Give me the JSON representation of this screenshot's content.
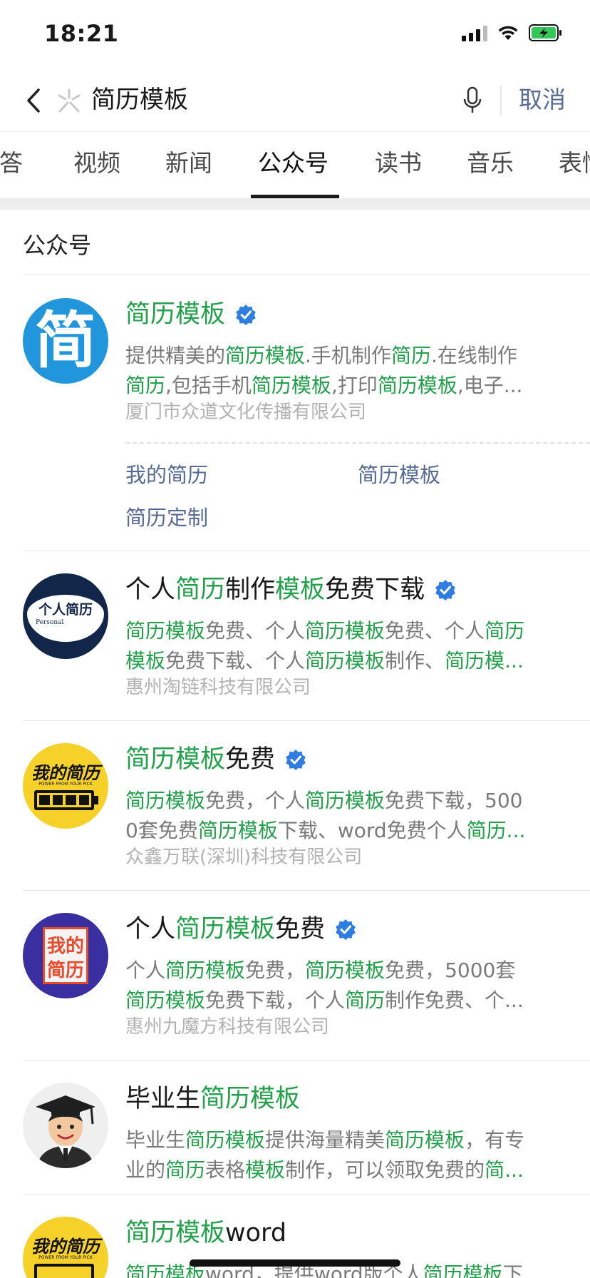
{
  "status_bar": {
    "time": "18:21"
  },
  "search": {
    "query": "简历模板",
    "cancel_label": "取消"
  },
  "tabs": [
    {
      "label": "问答"
    },
    {
      "label": "视频"
    },
    {
      "label": "新闻"
    },
    {
      "label": "公众号",
      "active": true
    },
    {
      "label": "读书"
    },
    {
      "label": "音乐"
    },
    {
      "label": "表情"
    }
  ],
  "section": {
    "title": "公众号"
  },
  "results": [
    {
      "title": [
        {
          "t": "简历模板",
          "hl": true
        }
      ],
      "verified": true,
      "desc": [
        [
          {
            "t": "提供精美的"
          },
          {
            "t": "简历模板",
            "hl": true
          },
          {
            "t": ".手机制作"
          },
          {
            "t": "简历",
            "hl": true
          },
          {
            "t": ".在线制作"
          }
        ],
        [
          {
            "t": "简历",
            "hl": true
          },
          {
            "t": ",包括手机"
          },
          {
            "t": "简历模板",
            "hl": true
          },
          {
            "t": ",打印"
          },
          {
            "t": "简历模板",
            "hl": true
          },
          {
            "t": ",电子..."
          }
        ]
      ],
      "company": "厦门市众道文化传播有限公司",
      "avatar_text": "简",
      "links": [
        "我的简历",
        "简历模板",
        "简历定制"
      ]
    },
    {
      "title": [
        {
          "t": "个人"
        },
        {
          "t": "简历",
          "hl": true
        },
        {
          "t": "制作"
        },
        {
          "t": "模板",
          "hl": true
        },
        {
          "t": "免费下载"
        }
      ],
      "verified": true,
      "desc": [
        [
          {
            "t": "简历模板",
            "hl": true
          },
          {
            "t": "免费、个人"
          },
          {
            "t": "简历模板",
            "hl": true
          },
          {
            "t": "免费、个人"
          },
          {
            "t": "简历",
            "hl": true
          }
        ],
        [
          {
            "t": "模板",
            "hl": true
          },
          {
            "t": "免费下载、个人"
          },
          {
            "t": "简历模板",
            "hl": true
          },
          {
            "t": "制作、"
          },
          {
            "t": "简历模...",
            "hl": true
          }
        ]
      ],
      "company": "惠州淘链科技有限公司",
      "avatar_text": "个人简历",
      "avatar_sub": "Personal"
    },
    {
      "title": [
        {
          "t": "简历模板",
          "hl": true
        },
        {
          "t": "免费"
        }
      ],
      "verified": true,
      "desc": [
        [
          {
            "t": "简历模板",
            "hl": true
          },
          {
            "t": "免费，个人"
          },
          {
            "t": "简历模板",
            "hl": true
          },
          {
            "t": "免费下载，500"
          }
        ],
        [
          {
            "t": "0套免费"
          },
          {
            "t": "简历模板",
            "hl": true
          },
          {
            "t": "下载、word免费个人"
          },
          {
            "t": "简历...",
            "hl": true
          }
        ]
      ],
      "company": "众鑫万联(深圳)科技有限公司",
      "avatar_text": "我的简历",
      "avatar_sub": "POWER FROM YOUR PICK"
    },
    {
      "title": [
        {
          "t": "个人"
        },
        {
          "t": "简历模板",
          "hl": true
        },
        {
          "t": "免费"
        }
      ],
      "verified": true,
      "desc": [
        [
          {
            "t": "个人"
          },
          {
            "t": "简历模板",
            "hl": true
          },
          {
            "t": "免费，"
          },
          {
            "t": "简历模板",
            "hl": true
          },
          {
            "t": "免费，5000套"
          }
        ],
        [
          {
            "t": "简历模板",
            "hl": true
          },
          {
            "t": "免费下载，个人"
          },
          {
            "t": "简历",
            "hl": true
          },
          {
            "t": "制作免费、个..."
          }
        ]
      ],
      "company": "惠州九魔方科技有限公司",
      "avatar_text_1": "我的",
      "avatar_text_2": "简历"
    },
    {
      "title": [
        {
          "t": "毕业生"
        },
        {
          "t": "简历模板",
          "hl": true
        }
      ],
      "verified": false,
      "desc": [
        [
          {
            "t": "毕业生"
          },
          {
            "t": "简历模板",
            "hl": true
          },
          {
            "t": "提供海量精美"
          },
          {
            "t": "简历模板",
            "hl": true
          },
          {
            "t": "，有专"
          }
        ],
        [
          {
            "t": "业的"
          },
          {
            "t": "简历",
            "hl": true
          },
          {
            "t": "表格"
          },
          {
            "t": "模板",
            "hl": true
          },
          {
            "t": "制作，可以领取免费的"
          },
          {
            "t": "简...",
            "hl": true
          }
        ]
      ]
    },
    {
      "title": [
        {
          "t": "简历模板",
          "hl": true
        },
        {
          "t": "word"
        }
      ],
      "verified": false,
      "desc": [
        [
          {
            "t": "简历模板",
            "hl": true
          },
          {
            "t": "word，提供word版个人"
          },
          {
            "t": "简历模板",
            "hl": true
          },
          {
            "t": "下"
          }
        ]
      ],
      "avatar_text": "我的简历",
      "avatar_sub": "POWER FROM YOUR PICK"
    }
  ],
  "colors": {
    "highlight": "#22a04a",
    "link": "#576b95",
    "verified": "#2f7de1"
  }
}
